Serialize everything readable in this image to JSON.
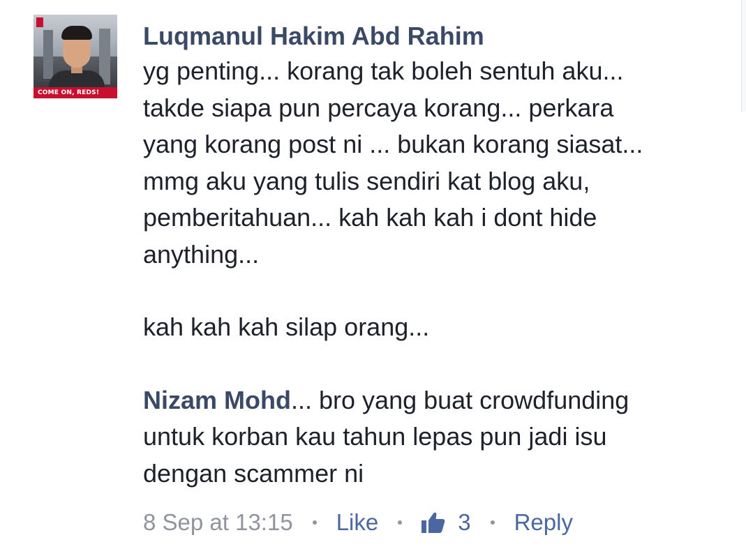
{
  "comment": {
    "avatar": {
      "icon": "profile-photo",
      "banner_text": "COME ON, REDS!",
      "brand_color": "#c8102e"
    },
    "author": "Luqmanul Hakim Abd Rahim",
    "lines_p1": [
      "yg penting... korang tak boleh sentuh aku...",
      "takde siapa pun percaya korang... perkara",
      "yang korang post ni ... bukan korang siasat...",
      "mmg aku yang tulis sendiri kat blog aku,",
      "pemberitahuan... kah kah kah i dont hide",
      "anything..."
    ],
    "line_p2": "kah kah kah silap orang...",
    "mention": "Nizam Mohd",
    "mention_suffix": "... bro yang buat crowdfunding",
    "lines_p3": [
      "untuk korban kau tahun lepas pun jadi isu",
      "dengan scammer ni"
    ],
    "meta": {
      "timestamp": "8 Sep at 13:15",
      "like_label": "Like",
      "like_icon": "thumbs-up-icon",
      "like_count": "3",
      "reply_label": "Reply"
    },
    "colors": {
      "author": "#3a4a66",
      "text": "#1d2129",
      "meta": "#90949c",
      "link": "#4b67a1"
    }
  }
}
